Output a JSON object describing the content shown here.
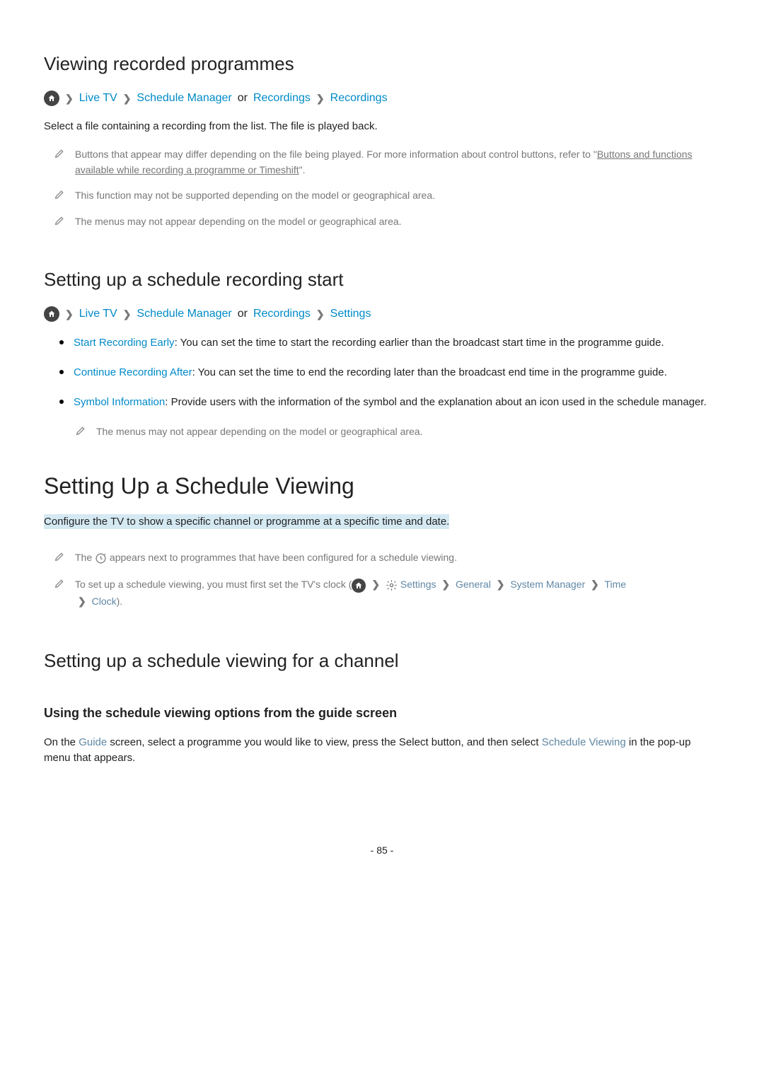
{
  "section1": {
    "title": "Viewing recorded programmes",
    "crumb": {
      "liveTv": "Live TV",
      "scheduleManager": "Schedule Manager",
      "or": "or",
      "recordings1": "Recordings",
      "recordings2": "Recordings"
    },
    "description": "Select a file containing a recording from the list. The file is played back.",
    "note1a": "Buttons that appear may differ depending on the file being played. For more information about control buttons, refer to \"",
    "note1link": "Buttons and functions available while recording a programme or Timeshift",
    "note1b": "\".",
    "note2": "This function may not be supported depending on the model or geographical area.",
    "note3": "The menus may not appear depending on the model or geographical area."
  },
  "section2": {
    "title": "Setting up a schedule recording start",
    "crumb": {
      "liveTv": "Live TV",
      "scheduleManager": "Schedule Manager",
      "or": "or",
      "recordings": "Recordings",
      "settings": "Settings"
    },
    "bullet1Label": "Start Recording Early",
    "bullet1Text": ": You can set the time to start the recording earlier than the broadcast start time in the programme guide.",
    "bullet2Label": "Continue Recording After",
    "bullet2Text": ": You can set the time to end the recording later than the broadcast end time in the programme guide.",
    "bullet3Label": "Symbol Information",
    "bullet3Text": ": Provide users with the information of the symbol and the explanation about an icon used in the schedule manager.",
    "nestedNote": "The menus may not appear depending on the model or geographical area."
  },
  "section3": {
    "title": "Setting Up a Schedule Viewing",
    "highlight": "Configure the TV to show a specific channel or programme at a specific time and date.",
    "note1a": "The ",
    "note1b": " appears next to programmes that have been configured for a schedule viewing.",
    "note2a": "To set up a schedule viewing, you must first set the TV's clock (",
    "settings": "Settings",
    "general": "General",
    "systemManager": "System Manager",
    "time": "Time",
    "clock": "Clock",
    "note2end": ")."
  },
  "section4": {
    "title": "Setting up a schedule viewing for a channel",
    "subtitle": "Using the schedule viewing options from the guide screen",
    "text1": "On the ",
    "guide": "Guide",
    "text2": " screen, select a programme you would like to view, press the Select button, and then select ",
    "scheduleViewing": "Schedule Viewing",
    "text3": " in the pop-up menu that appears."
  },
  "pageNum": "- 85 -"
}
